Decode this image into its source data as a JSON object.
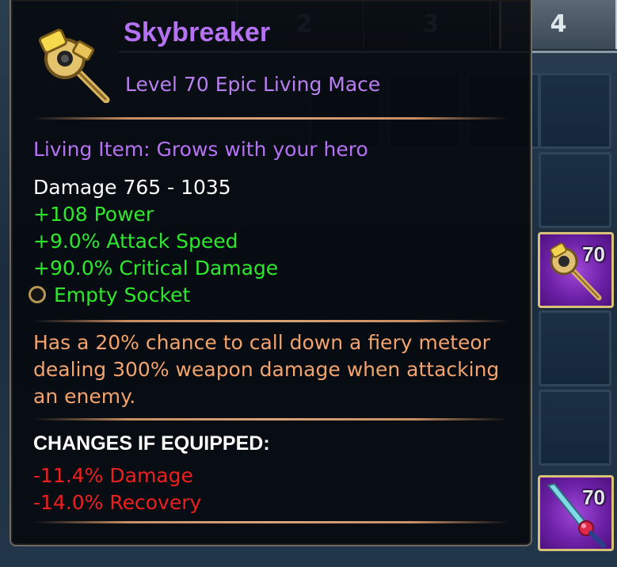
{
  "inventory": {
    "tabs": [
      "",
      "2",
      "3",
      "4"
    ],
    "active_tab": "4",
    "equipped_slots": [
      {
        "item": "mace",
        "level": "70"
      },
      {
        "item": "sword",
        "level": "70"
      }
    ]
  },
  "tooltip": {
    "name": "Skybreaker",
    "subtitle": "Level 70 Epic Living Mace",
    "living_note": "Living Item: Grows with your hero",
    "damage": "Damage 765 - 1035",
    "stats": [
      "+108 Power",
      "+9.0% Attack Speed",
      "+90.0% Critical Damage"
    ],
    "socket": "Empty Socket",
    "proc": "Has a 20% chance to call down a fiery meteor dealing 300% weapon damage when attacking an enemy.",
    "changes_header": "CHANGES IF EQUIPPED:",
    "changes": [
      "-11.4% Damage",
      "-14.0% Recovery"
    ]
  },
  "colors": {
    "epic_purple": "#b572f2",
    "stat_green": "#2ee82e",
    "proc_orange": "#f3a36b",
    "negative_red": "#ee1f1f"
  },
  "icons": [
    "mace-icon",
    "socket-icon",
    "sword-icon"
  ]
}
